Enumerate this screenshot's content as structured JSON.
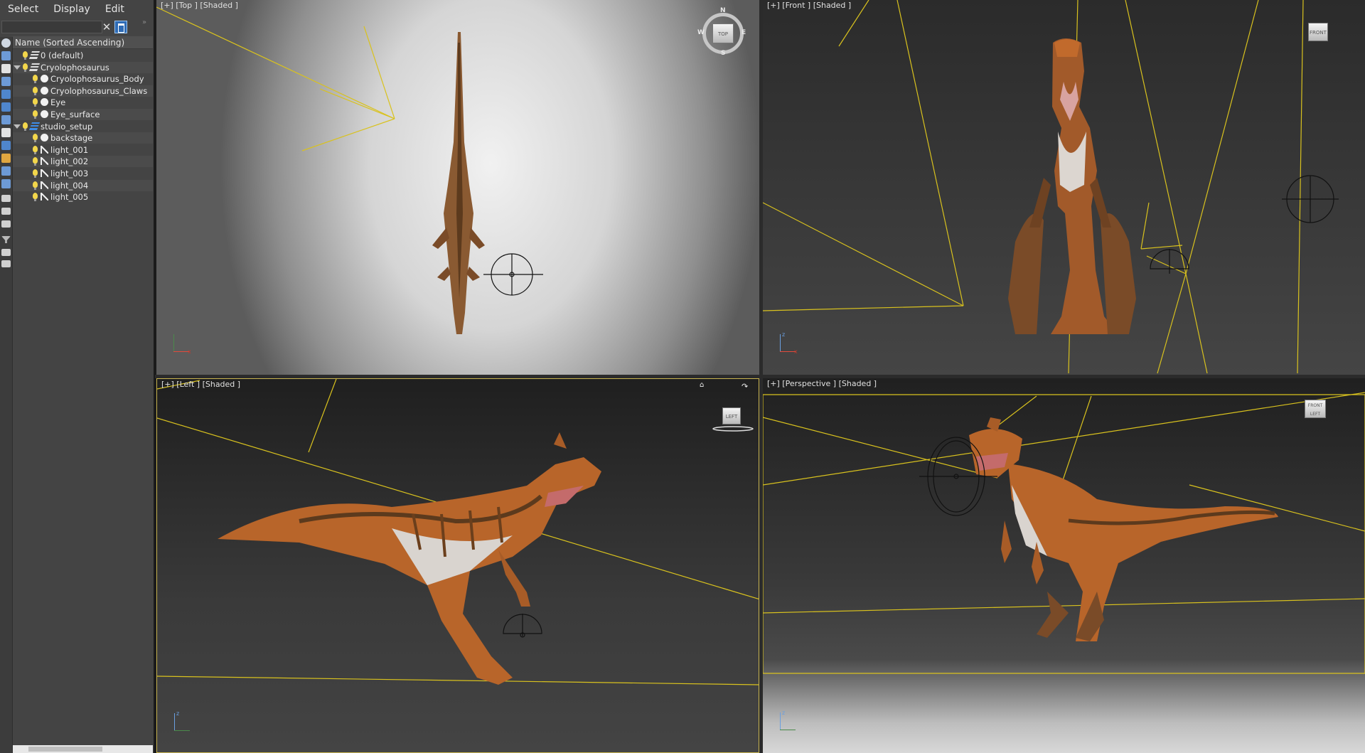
{
  "menu": {
    "select": "Select",
    "display": "Display",
    "edit": "Edit"
  },
  "search": {
    "value": "",
    "placeholder": ""
  },
  "explorer": {
    "column_header": "Name (Sorted Ascending)",
    "items": [
      {
        "label": "0 (default)",
        "level": 1,
        "icon": "layer-icon",
        "expandable": false
      },
      {
        "label": "Cryolophosaurus",
        "level": 1,
        "icon": "layer-icon",
        "expandable": true
      },
      {
        "label": "Cryolophosaurus_Body",
        "level": 2,
        "icon": "geometry-icon",
        "expandable": false
      },
      {
        "label": "Cryolophosaurus_Claws",
        "level": 2,
        "icon": "geometry-icon",
        "expandable": false
      },
      {
        "label": "Eye",
        "level": 2,
        "icon": "geometry-icon",
        "expandable": false
      },
      {
        "label": "Eye_surface",
        "level": 2,
        "icon": "geometry-icon",
        "expandable": false
      },
      {
        "label": "studio_setup",
        "level": 1,
        "icon": "layer-blue-icon",
        "expandable": true
      },
      {
        "label": "backstage",
        "level": 2,
        "icon": "geometry-icon",
        "expandable": false
      },
      {
        "label": "light_001",
        "level": 2,
        "icon": "light-icon",
        "expandable": false
      },
      {
        "label": "light_002",
        "level": 2,
        "icon": "light-icon",
        "expandable": false
      },
      {
        "label": "light_003",
        "level": 2,
        "icon": "light-icon",
        "expandable": false
      },
      {
        "label": "light_004",
        "level": 2,
        "icon": "light-icon",
        "expandable": false
      },
      {
        "label": "light_005",
        "level": 2,
        "icon": "light-icon",
        "expandable": false
      }
    ]
  },
  "viewports": {
    "top": {
      "label": "[+] [Top ] [Shaded ]",
      "cube_face": "TOP",
      "compass": {
        "n": "N",
        "s": "S",
        "e": "E",
        "w": "W"
      }
    },
    "front": {
      "label": "[+] [Front ] [Shaded ]",
      "cube_face": "FRONT"
    },
    "left": {
      "label": "[+] [Left ] [Shaded ]",
      "cube_face": "LEFT"
    },
    "perspective": {
      "label": "[+] [Perspective ] [Shaded ]",
      "cube_face": "FRONT LEFT"
    }
  },
  "axis": {
    "x": "x",
    "z": "z"
  },
  "colors": {
    "light_lines": "#d9c21e",
    "dino_orange": "#b8652a",
    "dino_dark": "#5c3a1d",
    "dino_belly": "#d9d4cf",
    "selection_blue": "#2e6bb5"
  }
}
